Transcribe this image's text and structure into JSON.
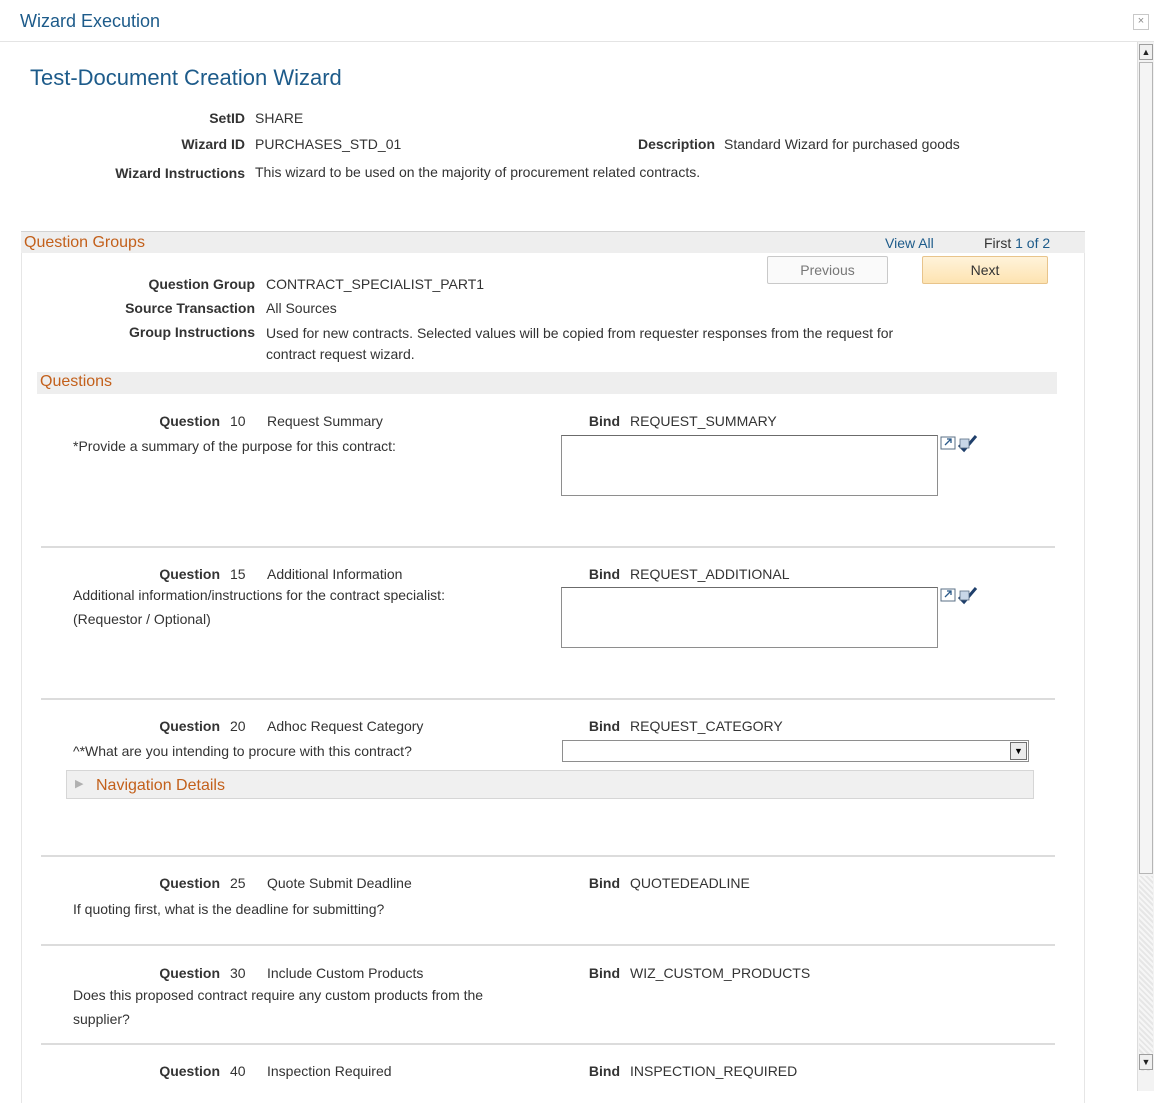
{
  "window": {
    "title": "Wizard Execution",
    "close_symbol": "×"
  },
  "page": {
    "title": "Test-Document Creation Wizard"
  },
  "header": {
    "setid_label": "SetID",
    "setid_value": "SHARE",
    "wizard_id_label": "Wizard ID",
    "wizard_id_value": "PURCHASES_STD_01",
    "description_label": "Description",
    "description_value": "Standard Wizard for purchased goods",
    "instructions_label": "Wizard Instructions",
    "instructions_value": "This wizard to be used on the majority of procurement related contracts."
  },
  "question_groups": {
    "title": "Question Groups",
    "view_all": "View All",
    "first": "First",
    "pagination": "1 of 2",
    "previous_button": "Previous",
    "next_button": "Next",
    "question_group_label": "Question Group",
    "question_group_value": "CONTRACT_SPECIALIST_PART1",
    "source_transaction_label": "Source Transaction",
    "source_transaction_value": "All Sources",
    "group_instructions_label": "Group Instructions",
    "group_instructions_line1": "Used for new contracts.  Selected values will be copied from requester responses from the request for",
    "group_instructions_line2": "contract request wizard."
  },
  "questions": {
    "title": "Questions",
    "question_label": "Question",
    "bind_label": "Bind",
    "navigation_details": "Navigation Details",
    "items": [
      {
        "number": "10",
        "name": "Request Summary",
        "bind": "REQUEST_SUMMARY",
        "prompt": [
          "*Provide a summary of the purpose for this contract:"
        ],
        "response_value": ""
      },
      {
        "number": "15",
        "name": "Additional Information",
        "bind": "REQUEST_ADDITIONAL",
        "prompt": [
          "Additional information/instructions for the contract specialist:",
          "(Requestor / Optional)"
        ],
        "response_value": ""
      },
      {
        "number": "20",
        "name": "Adhoc Request Category",
        "bind": "REQUEST_CATEGORY",
        "prompt": [
          "^*What are you intending to procure with this contract?"
        ],
        "selected_value": ""
      },
      {
        "number": "25",
        "name": "Quote Submit Deadline",
        "bind": "QUOTEDEADLINE",
        "prompt": [
          "If quoting first, what is the deadline for submitting?"
        ]
      },
      {
        "number": "30",
        "name": "Include Custom Products",
        "bind": "WIZ_CUSTOM_PRODUCTS",
        "prompt": [
          "Does this proposed contract require any custom products from the",
          "supplier?"
        ]
      },
      {
        "number": "40",
        "name": "Inspection Required",
        "bind": "INSPECTION_REQUIRED",
        "prompt": []
      }
    ]
  },
  "icons": {
    "close": "close-icon",
    "expand": "expand-textarea-icon",
    "spellcheck": "spell-check-icon",
    "dropdown": "dropdown-arrow-icon",
    "collapsed": "triangle-right-icon",
    "scroll_up": "scroll-up-arrow-icon",
    "scroll_down": "scroll-down-arrow-icon"
  },
  "colors": {
    "link": "#1d5b8a",
    "section_title": "#c3601b",
    "primary_button": "#fde3b1"
  }
}
